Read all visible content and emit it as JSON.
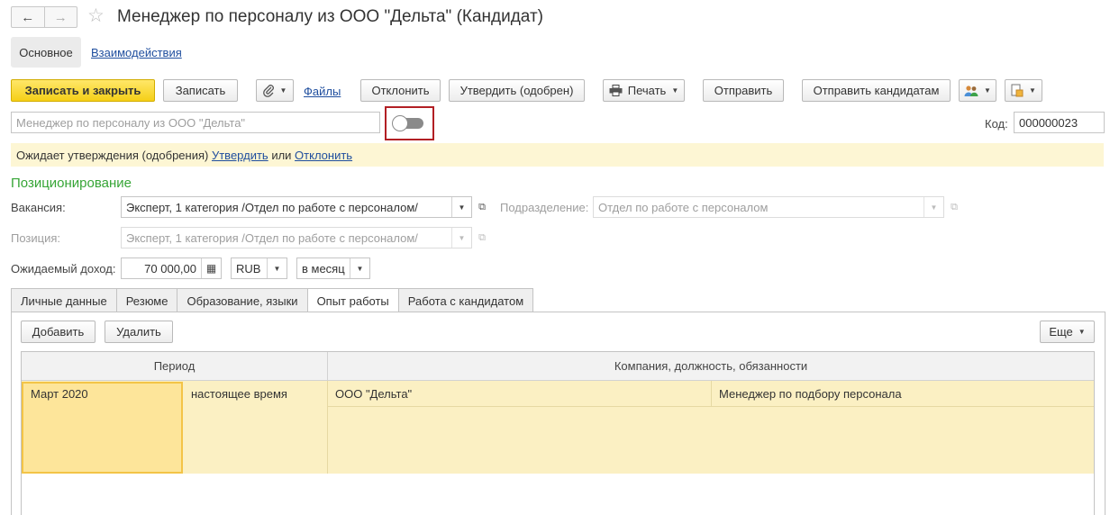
{
  "window": {
    "back_icon": "arrow-left-icon",
    "forward_icon": "arrow-right-icon",
    "favorite_icon": "star-icon",
    "title": "Менеджер по персоналу из ООО \"Дельта\" (Кандидат)"
  },
  "sections": {
    "main": "Основное",
    "interactions": "Взаимодействия"
  },
  "toolbar": {
    "save_close": "Записать и закрыть",
    "save": "Записать",
    "attach_icon": "paperclip-icon",
    "files": "Файлы",
    "reject": "Отклонить",
    "approve": "Утвердить (одобрен)",
    "print": "Печать",
    "print_icon": "printer-icon",
    "send": "Отправить",
    "send_candidates": "Отправить кандидатам",
    "users_icon": "users-icon",
    "report_icon": "report-icon"
  },
  "header": {
    "name_placeholder": "Менеджер по персоналу из ООО \"Дельта\"",
    "code_label": "Код:",
    "code_value": "000000023"
  },
  "banner": {
    "prefix": "Ожидает утверждения (одобрения)",
    "approve_link": "Утвердить",
    "or": "или",
    "reject_link": "Отклонить"
  },
  "positioning": {
    "title": "Позиционирование",
    "vacancy_label": "Вакансия:",
    "vacancy_value": "Эксперт, 1 категория /Отдел по работе с персоналом/",
    "department_label": "Подразделение:",
    "department_value": "Отдел по работе с персоналом",
    "position_label": "Позиция:",
    "position_value": "Эксперт, 1 категория /Отдел по работе с персоналом/",
    "income_label": "Ожидаемый доход:",
    "income_value": "70 000,00",
    "currency": "RUB",
    "period": "в месяц"
  },
  "tabs": [
    "Личные данные",
    "Резюме",
    "Образование, языки",
    "Опыт работы",
    "Работа с кандидатом"
  ],
  "active_tab": "Опыт работы",
  "experience": {
    "add": "Добавить",
    "delete": "Удалить",
    "more": "Еще",
    "columns": [
      "Период",
      "Компания, должность, обязанности"
    ],
    "rows": [
      {
        "from": "Март 2020",
        "to": "настоящее время",
        "company": "ООО \"Дельта\"",
        "role": "Менеджер по подбору персонала"
      }
    ]
  },
  "colors": {
    "primary_button": "#f5cf17",
    "banner": "#fdf6d4",
    "group_title": "#36a536",
    "toggle_highlight": "#b21f24",
    "selected_row": "#fbf0c3"
  }
}
